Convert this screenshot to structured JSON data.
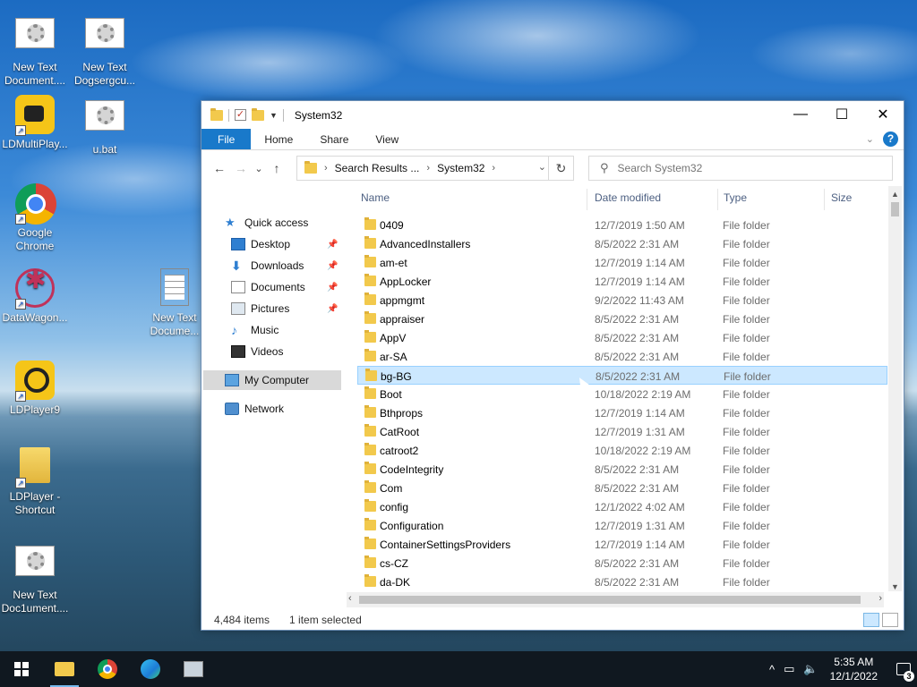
{
  "desktop_icons": [
    {
      "label": "New Text Document....",
      "icon": "text-document-icon"
    },
    {
      "label": "New Text Dogsergcu...",
      "icon": "text-document-icon"
    },
    {
      "label": "LDMultiPlay...",
      "icon": "ldmultiplayer-icon"
    },
    {
      "label": "u.bat",
      "icon": "batch-file-icon"
    },
    {
      "label": "Google Chrome",
      "icon": "chrome-icon"
    },
    {
      "label": "DataWagon...",
      "icon": "datawagon-icon"
    },
    {
      "label": "New Text Docume...",
      "icon": "text-file-icon"
    },
    {
      "label": "LDPlayer9",
      "icon": "ldplayer-icon"
    },
    {
      "label": "LDPlayer - Shortcut",
      "icon": "folder-shortcut-icon"
    },
    {
      "label": "New Text Doc1ument....",
      "icon": "text-document-icon"
    }
  ],
  "window": {
    "title": "System32",
    "controls": {
      "minimize": "—",
      "maximize": "☐",
      "close": "✕"
    }
  },
  "ribbon": {
    "tabs": [
      "File",
      "Home",
      "Share",
      "View"
    ],
    "active_tab": "File",
    "accent": "#1979ca"
  },
  "navigation": {
    "back": "←",
    "forward": "→",
    "recent": "⌄",
    "up": "↑",
    "address": [
      "Search Results ...",
      "System32"
    ],
    "search_placeholder": "Search System32"
  },
  "nav_pane": [
    {
      "label": "Quick access",
      "icon": "star-icon",
      "pinned": false
    },
    {
      "label": "Desktop",
      "icon": "desktop-icon",
      "pinned": true
    },
    {
      "label": "Downloads",
      "icon": "download-icon",
      "pinned": true
    },
    {
      "label": "Documents",
      "icon": "documents-icon",
      "pinned": true
    },
    {
      "label": "Pictures",
      "icon": "pictures-icon",
      "pinned": true
    },
    {
      "label": "Music",
      "icon": "music-icon",
      "pinned": false
    },
    {
      "label": "Videos",
      "icon": "videos-icon",
      "pinned": false
    },
    {
      "label": "My Computer",
      "icon": "computer-icon",
      "pinned": false,
      "selected": true
    },
    {
      "label": "Network",
      "icon": "network-icon",
      "pinned": false
    }
  ],
  "columns": [
    "Name",
    "Date modified",
    "Type",
    "Size"
  ],
  "files": [
    {
      "name": "0409",
      "date": "12/7/2019 1:50 AM",
      "type": "File folder"
    },
    {
      "name": "AdvancedInstallers",
      "date": "8/5/2022 2:31 AM",
      "type": "File folder"
    },
    {
      "name": "am-et",
      "date": "12/7/2019 1:14 AM",
      "type": "File folder"
    },
    {
      "name": "AppLocker",
      "date": "12/7/2019 1:14 AM",
      "type": "File folder"
    },
    {
      "name": "appmgmt",
      "date": "9/2/2022 11:43 AM",
      "type": "File folder"
    },
    {
      "name": "appraiser",
      "date": "8/5/2022 2:31 AM",
      "type": "File folder"
    },
    {
      "name": "AppV",
      "date": "8/5/2022 2:31 AM",
      "type": "File folder"
    },
    {
      "name": "ar-SA",
      "date": "8/5/2022 2:31 AM",
      "type": "File folder"
    },
    {
      "name": "bg-BG",
      "date": "8/5/2022 2:31 AM",
      "type": "File folder",
      "selected": true
    },
    {
      "name": "Boot",
      "date": "10/18/2022 2:19 AM",
      "type": "File folder"
    },
    {
      "name": "Bthprops",
      "date": "12/7/2019 1:14 AM",
      "type": "File folder"
    },
    {
      "name": "CatRoot",
      "date": "12/7/2019 1:31 AM",
      "type": "File folder"
    },
    {
      "name": "catroot2",
      "date": "10/18/2022 2:19 AM",
      "type": "File folder"
    },
    {
      "name": "CodeIntegrity",
      "date": "8/5/2022 2:31 AM",
      "type": "File folder"
    },
    {
      "name": "Com",
      "date": "8/5/2022 2:31 AM",
      "type": "File folder"
    },
    {
      "name": "config",
      "date": "12/1/2022 4:02 AM",
      "type": "File folder"
    },
    {
      "name": "Configuration",
      "date": "12/7/2019 1:31 AM",
      "type": "File folder"
    },
    {
      "name": "ContainerSettingsProviders",
      "date": "12/7/2019 1:14 AM",
      "type": "File folder"
    },
    {
      "name": "cs-CZ",
      "date": "8/5/2022 2:31 AM",
      "type": "File folder"
    },
    {
      "name": "da-DK",
      "date": "8/5/2022 2:31 AM",
      "type": "File folder"
    }
  ],
  "status": {
    "item_count": "4,484 items",
    "selection": "1 item selected"
  },
  "taskbar": {
    "apps": [
      "start-icon",
      "file-explorer-icon",
      "chrome-icon",
      "edge-icon",
      "app-window-icon"
    ],
    "time": "5:35 AM",
    "date": "12/1/2022",
    "notification_count": "3"
  }
}
